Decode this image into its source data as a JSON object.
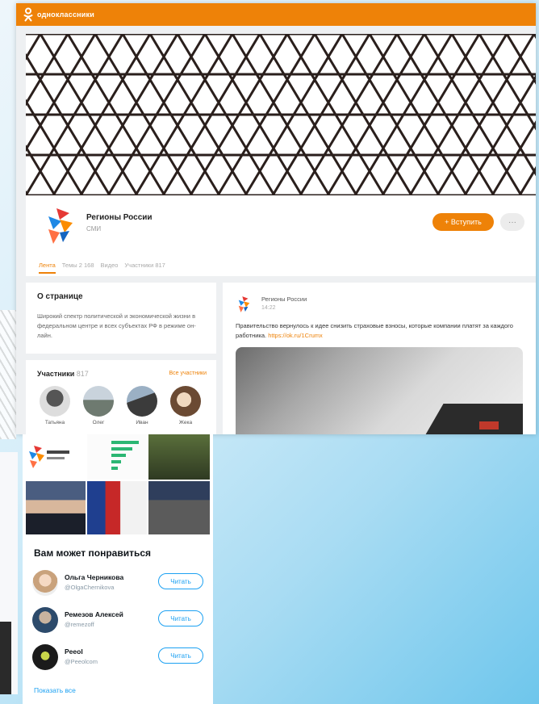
{
  "ok": {
    "brand": "одноклассники",
    "group_name": "Регионы России",
    "group_type": "СМИ",
    "join_button": "+ Вступить",
    "more_button": "···",
    "tabs": [
      {
        "label": "Лента",
        "active": true
      },
      {
        "label": "Темы 2 168",
        "active": false
      },
      {
        "label": "Видео",
        "active": false
      },
      {
        "label": "Участники 817",
        "active": false
      }
    ],
    "about": {
      "title": "О странице",
      "text": "Широкий спектр политической и экономической жизни в федеральном центре и всех субъектах РФ в режиме он-лайн."
    },
    "members": {
      "title": "Участники",
      "count": "817",
      "all_link": "Все участники",
      "items": [
        {
          "name": "Татьяна"
        },
        {
          "name": "Олег"
        },
        {
          "name": "Иван"
        },
        {
          "name": "Жека"
        }
      ]
    },
    "post": {
      "author": "Регионы России",
      "time": "14:22",
      "text": "Правительство вернулось к идее снизить страховые взносы, которые компании платят за каждого работника.",
      "link": "https://ok.ru/1Crumx"
    },
    "accent_color": "#ee8208"
  },
  "twitter": {
    "title": "Вам может понравиться",
    "items": [
      {
        "name": "Ольга Черникова",
        "handle": "@OlgaChernikova",
        "button": "Читать"
      },
      {
        "name": "Ремезов Алексей",
        "handle": "@remezoff",
        "button": "Читать"
      },
      {
        "name": "Peeol",
        "handle": "@Peeolcom",
        "button": "Читать"
      }
    ],
    "show_all": "Показать все",
    "accent_color": "#1da1f2"
  }
}
